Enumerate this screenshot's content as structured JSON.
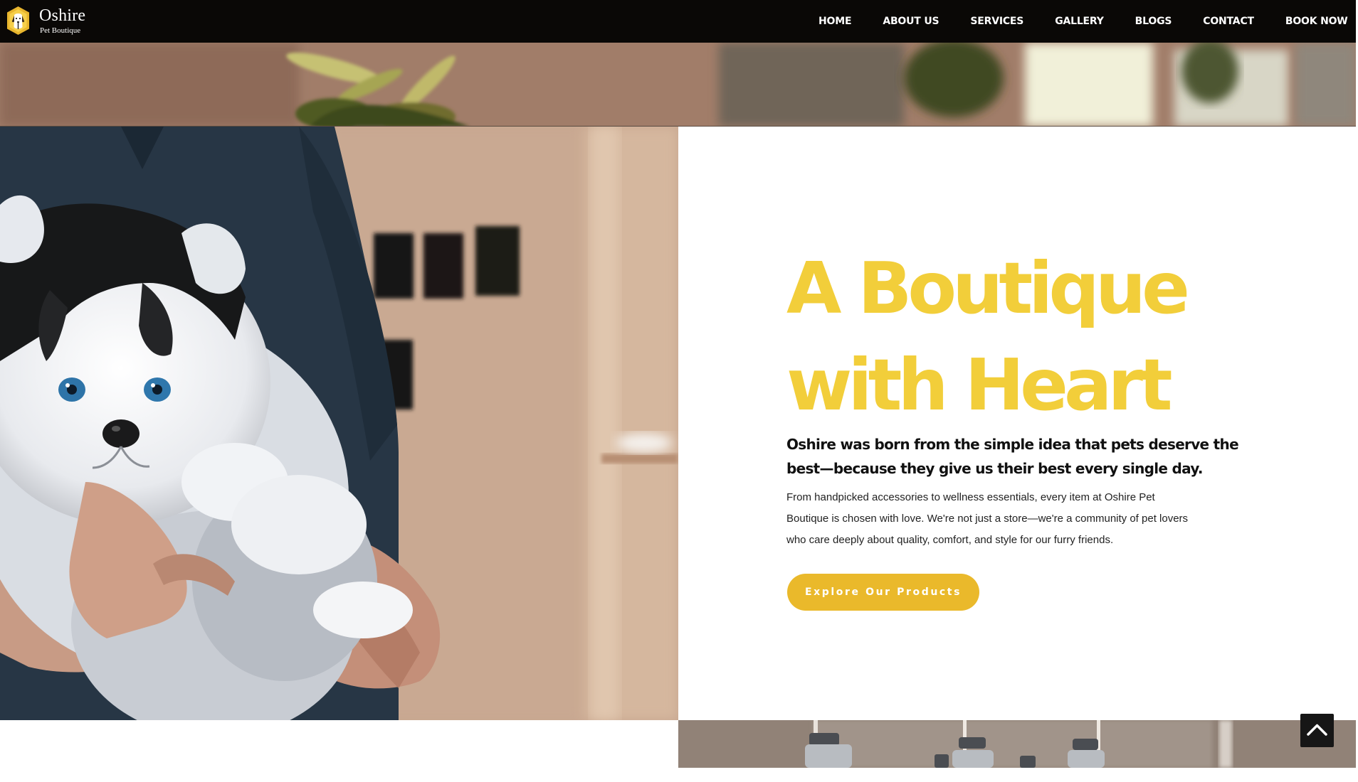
{
  "brand": {
    "name": "Oshire",
    "tagline": "Pet Boutique"
  },
  "nav": {
    "items": [
      {
        "label": "HOME"
      },
      {
        "label": "ABOUT US"
      },
      {
        "label": "SERVICES"
      },
      {
        "label": "GALLERY"
      },
      {
        "label": "BLOGS"
      },
      {
        "label": "CONTACT"
      },
      {
        "label": "BOOK NOW"
      }
    ]
  },
  "hero": {
    "title_line1": "A Boutique",
    "title_line2": "with Heart",
    "subtitle": "Oshire was born from the simple idea that pets deserve the best—because they give us their best every single day.",
    "body": "From handpicked accessories to wellness essentials, every item at Oshire Pet Boutique is chosen with love. We're not just a store—we're a community of pet lovers who care deeply about quality, comfort, and style for our furry friends.",
    "cta_label": "Explore Our Products"
  },
  "colors": {
    "nav_bg": "#0a0806",
    "accent_yellow": "#f2ce3a",
    "button_yellow": "#eab92b",
    "text_dark": "#111111"
  },
  "icons": {
    "logo": "dog-badge-logo-icon",
    "scroll_top": "chevron-up-icon"
  }
}
